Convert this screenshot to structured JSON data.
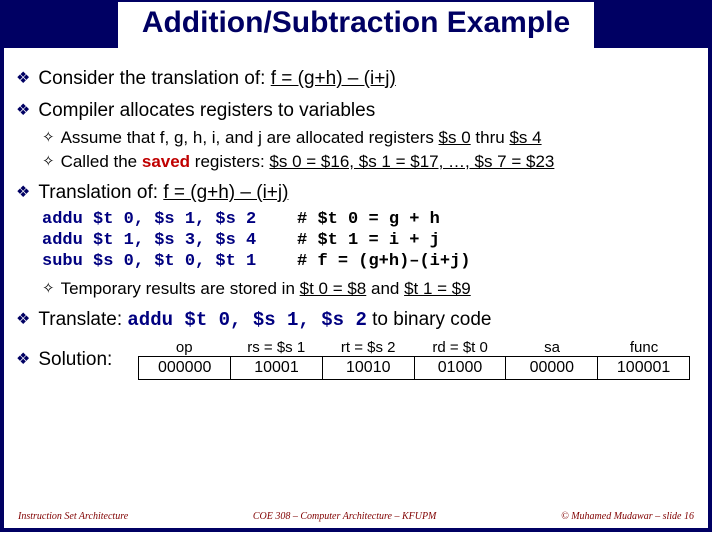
{
  "title": "Addition/Subtraction Example",
  "bullets": {
    "b1": {
      "pre": "Consider the translation of: ",
      "expr": "f = (g+h) – (i+j)"
    },
    "b2": "Compiler allocates registers to variables",
    "b2a": {
      "t1": "Assume that f, g, h, i, and j are allocated registers ",
      "t2": "$s 0",
      "t3": " thru ",
      "t4": "$s 4"
    },
    "b2b": {
      "t1": "Called the ",
      "saved": "saved",
      "t2": " registers: ",
      "eq": "$s 0 = $16, $s 1 = $17, …, $s 7 = $23"
    },
    "b3": {
      "pre": "Translation of: ",
      "expr": "f = (g+h) – (i+j)"
    },
    "code": {
      "l1a": "addu $t 0, $s 1, $s 2    ",
      "l1b": "# $t 0 = g + h",
      "l2a": "addu $t 1, $s 3, $s 4    ",
      "l2b": "# $t 1 = i + j",
      "l3a": "subu $s 0, $t 0, $t 1    ",
      "l3b": "# f = (g+h)–(i+j)"
    },
    "b4": {
      "t1": "Temporary results are stored in ",
      "r1": "$t 0 = $8",
      "t2": " and ",
      "r2": "$t 1 = $9"
    },
    "b5": {
      "t1": "Translate: ",
      "code": "addu $t 0, $s 1, $s 2",
      "t2": " to binary code"
    },
    "b6": "Solution:"
  },
  "table": {
    "hdr": {
      "op": "op",
      "rs": "rs = $s 1",
      "rt": "rt = $s 2",
      "rd": "rd = $t 0",
      "sa": "sa",
      "func": "func"
    },
    "row": {
      "op": "000000",
      "rs": "10001",
      "rt": "10010",
      "rd": "01000",
      "sa": "00000",
      "func": "100001"
    }
  },
  "footer": {
    "left": "Instruction Set Architecture",
    "center": "COE 308 – Computer Architecture – KFUPM",
    "right": "© Muhamed Mudawar – slide 16"
  }
}
